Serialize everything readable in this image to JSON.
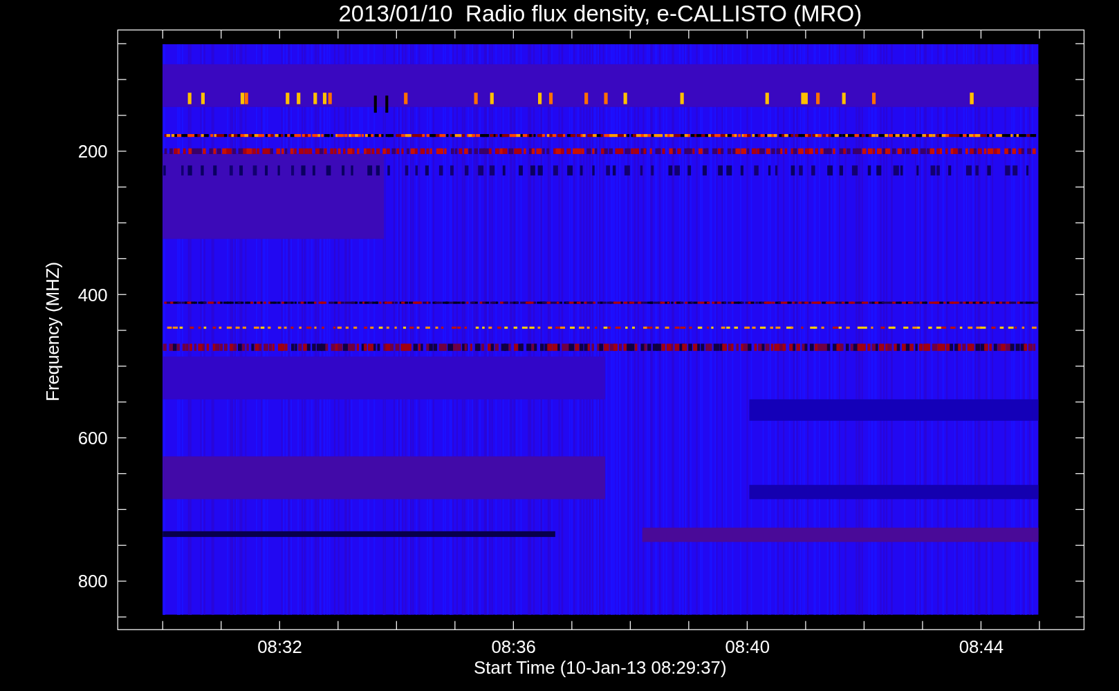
{
  "title": "2013/01/10  Radio flux density, e-CALLISTO (MRO)",
  "y_axis": {
    "label": "Frequency (MHZ)",
    "ticks": [
      "200",
      "400",
      "600",
      "800"
    ]
  },
  "x_axis": {
    "label": "Start Time (10-Jan-13 08:29:37)",
    "ticks": [
      "08:32",
      "08:36",
      "08:40",
      "08:44"
    ]
  }
}
